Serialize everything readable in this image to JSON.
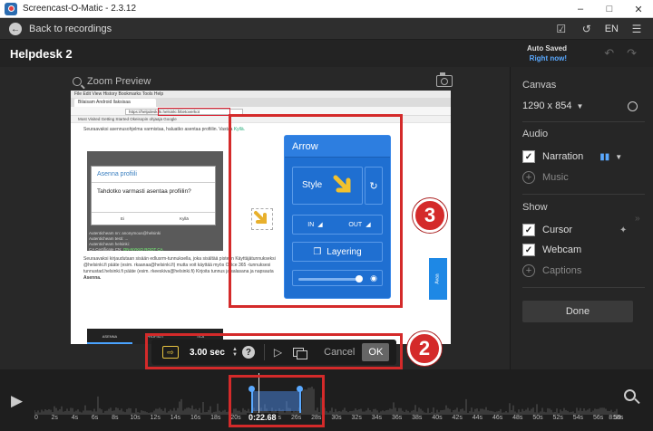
{
  "window": {
    "title": "Screencast-O-Matic - 2.3.12"
  },
  "header": {
    "back_label": "Back to recordings",
    "lang": "EN"
  },
  "project": {
    "title": "Helpdesk 2",
    "autosaved_line1": "Auto Saved",
    "autosaved_line2": "Right now!"
  },
  "preview": {
    "zoom_label": "Zoom Preview"
  },
  "browser": {
    "menubar": "File  Edit  View  History  Bookmarks  Tools  Help",
    "tab": "Bilaisam Android llaksisaa",
    "url": "https://helpdesk.hi.helsinki.fi/tietoverkot",
    "bookmarks": "Most Visited   Getting Started   Okeisopin ohjaaja   Google"
  },
  "doc": {
    "line1": "Seuraavaksi asennusohjelma varmistaa, haluatko asentaa profiilin. Vastaa ",
    "line1_hl": "Kyllä.",
    "dialog_title": "Asenna profiili",
    "dialog_text": "Tahdotko varmasti asentaa profiilin?",
    "dialog_btn_no": "Ei",
    "dialog_btn_yes": "Kyllä",
    "small1": "Autenticheam nn: anonymous@helsinki",
    "small2": "Autenticheam testi: ...",
    "small3": "Autenticheam helsinki:",
    "small4": "CA Certificate CN: ",
    "small4_hl": "ON-NYKIO ROOT CA",
    "line2": "Seuraavaksi kirjaudutaan sisään edlusrm-tunnuksella, joka sisältää pisteen Käyttäjätunnukseksi",
    "line3": "@helsinki.fi  pääte (esim. rkaanaa@helsinki.fi) mutta voit käyttää myös Office 365 -tunnuksesi",
    "line4": "tunnustad.helsinki.fi pääte (esim. rkeeskiva@helsinki.fi) Kirjoita tunnus ja salasana ja napsauta",
    "line5": "Asenna.",
    "nav": [
      "ASENNA",
      "PROFIILIT",
      "TILA"
    ],
    "blue_tab": "Avaa"
  },
  "arrow_panel": {
    "title": "Arrow",
    "style_label": "Style",
    "in_label": "IN",
    "out_label": "OUT",
    "layering_label": "Layering",
    "opacity": 0.95
  },
  "callouts": [
    "1",
    "2",
    "3"
  ],
  "toolbar": {
    "duration": "3.00 sec",
    "cancel_label": "Cancel",
    "ok_label": "OK"
  },
  "right_panel": {
    "canvas_heading": "Canvas",
    "canvas_size": "1290 x 854",
    "audio_heading": "Audio",
    "narration": "Narration",
    "music": "Music",
    "show_heading": "Show",
    "cursor": "Cursor",
    "webcam": "Webcam",
    "captions": "Captions",
    "done_label": "Done"
  },
  "timeline": {
    "cursor_time": "0:22.68",
    "start_label": "0",
    "end_label": "8:59",
    "tick_labels": [
      "2s",
      "4s",
      "6s",
      "8s",
      "10s",
      "12s",
      "14s",
      "16s",
      "18s",
      "20s",
      "22s",
      "24s",
      "26s",
      "28s",
      "30s",
      "32s",
      "34s",
      "36s",
      "38s",
      "40s",
      "42s",
      "44s",
      "46s",
      "48s",
      "50s",
      "52s",
      "54s",
      "56s",
      "58s"
    ]
  },
  "colors": {
    "accent": "#5aa9ff",
    "callout": "#d42a2a",
    "panel_blue": "#1f6fd1",
    "yellow": "#e8c440"
  }
}
